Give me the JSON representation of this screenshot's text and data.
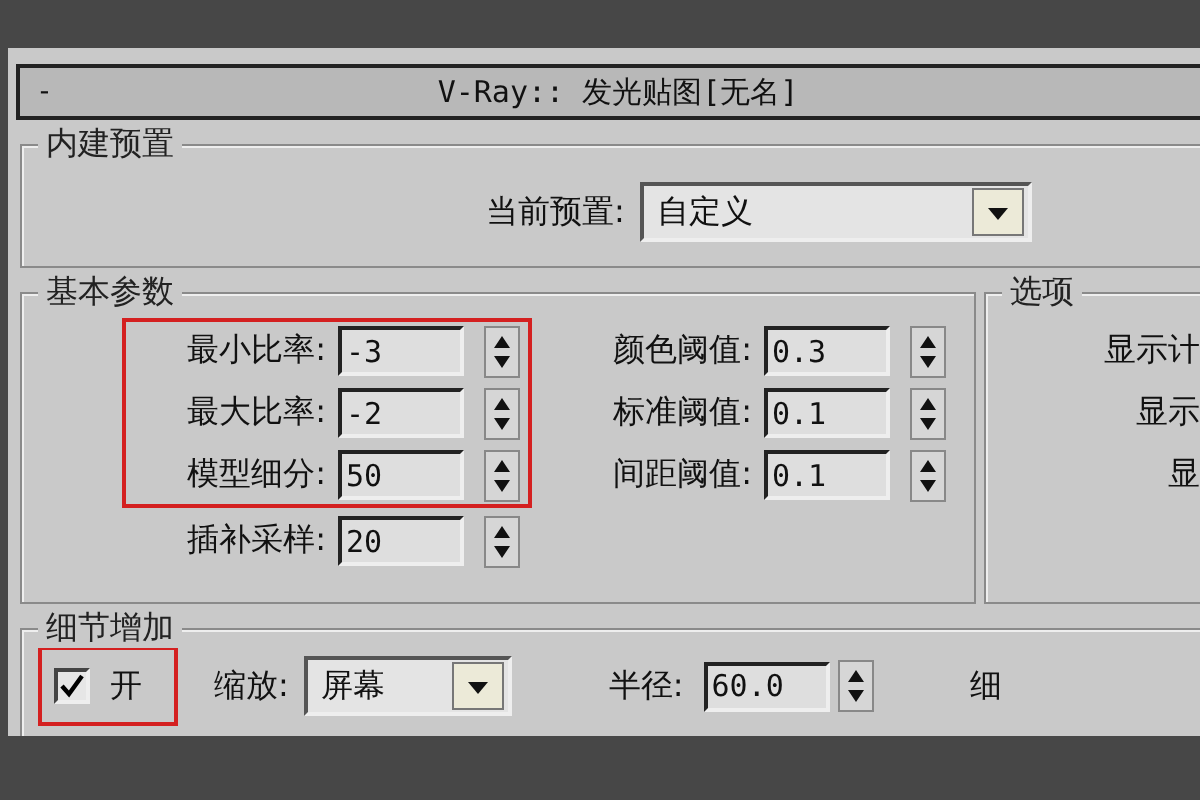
{
  "title_bar": {
    "collapse": "-",
    "title": "V-Ray:: 发光贴图[无名]"
  },
  "builtin_presets": {
    "title": "内建预置",
    "label": "当前预置:",
    "dropdown": {
      "value": "自定义"
    }
  },
  "basic_params": {
    "title": "基本参数",
    "column_1": [
      {
        "label": "最小比率:",
        "value": "-3",
        "highlighted": true
      },
      {
        "label": "最大比率:",
        "value": "-2",
        "highlighted": true
      },
      {
        "label": "模型细分:",
        "value": "50",
        "highlighted": true
      },
      {
        "label": "插补采样:",
        "value": "20",
        "highlighted": false
      }
    ],
    "column_2": [
      {
        "label": "颜色阈值:",
        "value": "0.3",
        "highlighted": false
      },
      {
        "label": "标准阈值:",
        "value": "0.1",
        "highlighted": false
      },
      {
        "label": "间距阈值:",
        "value": "0.1",
        "highlighted": false
      }
    ]
  },
  "options": {
    "title": "选项",
    "lines": [
      "显示计",
      "显示",
      "显"
    ]
  },
  "detail": {
    "title": "细节增加",
    "checkbox": {
      "label": "开",
      "checked": true,
      "highlighted": true
    },
    "scale_label": "缩放:",
    "scale_dropdown": {
      "value": "屏幕"
    },
    "radius_label": "半径:",
    "radius": "60.0",
    "column_cut": "细"
  }
}
